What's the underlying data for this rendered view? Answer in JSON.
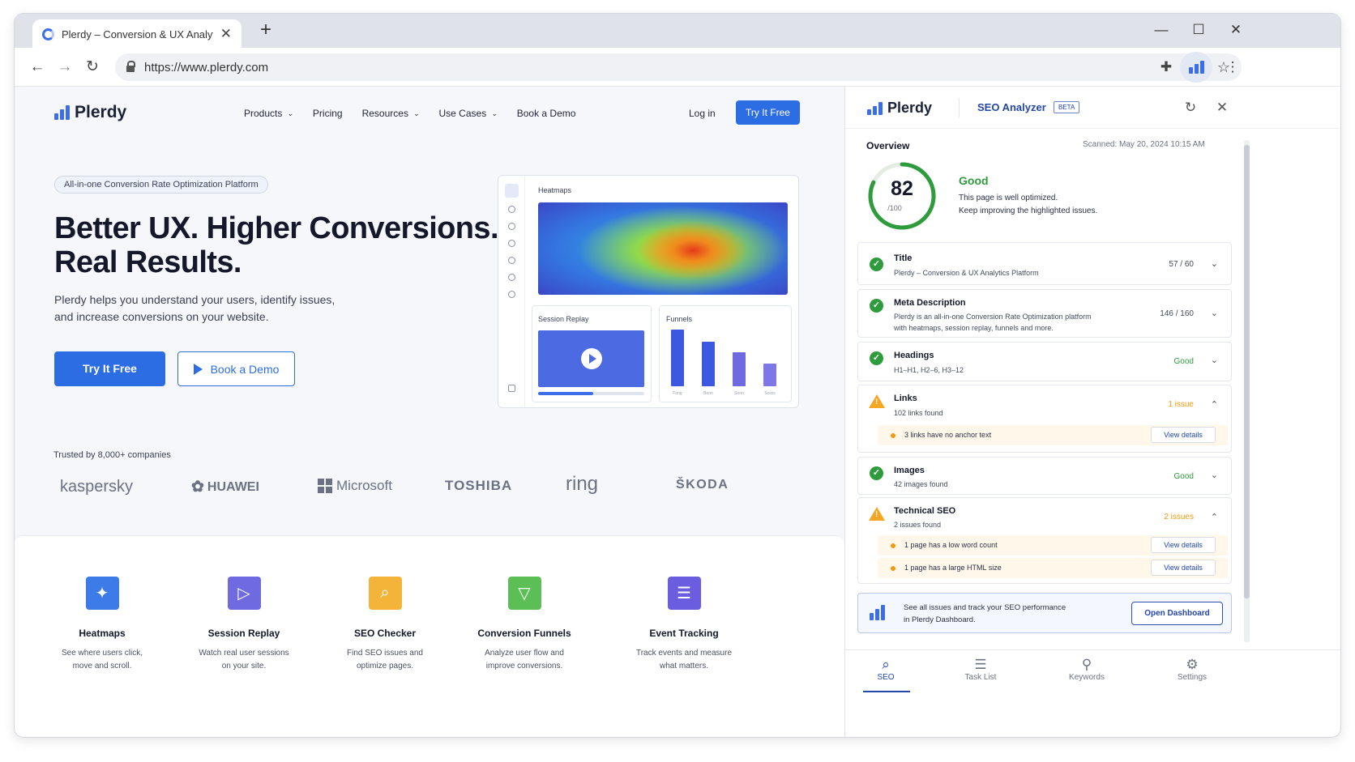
{
  "browser": {
    "tab_title": "Plerdy – Conversion & UX Analytics",
    "url": "https://www.plerdy.com",
    "new_tab": "+",
    "close_tab": "✕",
    "minimize": "—",
    "maximize": "☐",
    "close": "✕",
    "back": "←",
    "forward": "→",
    "reload": "↻",
    "star": "☆",
    "puzzle": "✚",
    "menu": "⋮"
  },
  "site": {
    "logo": "Plerdy",
    "nav": [
      {
        "label": "Products",
        "dropdown": "⌄"
      },
      {
        "label": "Pricing"
      },
      {
        "label": "Resources",
        "dropdown": "⌄"
      },
      {
        "label": "Use Cases",
        "dropdown": "⌄"
      },
      {
        "label": "Book a Demo"
      }
    ],
    "login": "Log in",
    "try_free_top": "Try It Free",
    "pill": "All-in-one Conversion Rate Optimization Platform",
    "headline_1": "Better UX. Higher Conversions.",
    "headline_2": "Real Results.",
    "subtext_1": "Plerdy helps you understand your users, identify issues,",
    "subtext_2": "and increase conversions on your website.",
    "cta_primary": "Try It Free",
    "cta_secondary": "Book a Demo",
    "mockup": {
      "heatmaps": "Heatmaps",
      "session_replay": "Session Replay",
      "session_progress": 0.52,
      "funnels": "Funnels",
      "funnel_values": [
        100,
        78,
        60,
        40
      ],
      "funnel_ticks": [
        "Fung",
        "Boon",
        "Soon",
        "Sosss"
      ]
    },
    "trusted": "Trusted by 8,000+ companies",
    "companies": [
      "kaspersky",
      "HUAWEI",
      "Microsoft",
      "TOSHIBA",
      "ring",
      "ŠKODA"
    ],
    "features": [
      {
        "title": "Heatmaps",
        "desc1": "See where users click,",
        "desc2": "move and scroll.",
        "color": "#3d7be9",
        "glyph": "✦"
      },
      {
        "title": "Session Replay",
        "desc1": "Watch real user sessions",
        "desc2": "on your site.",
        "color": "#6f6ae0",
        "glyph": "▷"
      },
      {
        "title": "SEO Checker",
        "desc1": "Find SEO issues and",
        "desc2": "optimize pages.",
        "color": "#f4b43a",
        "glyph": "⌕"
      },
      {
        "title": "Conversion Funnels",
        "desc1": "Analyze user flow and",
        "desc2": "improve conversions.",
        "color": "#5cbf55",
        "glyph": "▽"
      },
      {
        "title": "Event Tracking",
        "desc1": "Track events and measure",
        "desc2": "what matters.",
        "color": "#6b5de0",
        "glyph": "☰"
      }
    ]
  },
  "panel": {
    "logo": "Plerdy",
    "title": "SEO Analyzer",
    "beta": "BETA",
    "refresh": "↻",
    "close": "✕",
    "overview": "Overview",
    "scanned": "Scanned: May 20, 2024 10:15 AM",
    "score": "82",
    "score_max": "/100",
    "score_fraction": 0.82,
    "score_label": "Good",
    "score_text_1": "This page is well optimized.",
    "score_text_2": "Keep improving the highlighted issues.",
    "check_glyph": "✓",
    "warn_glyph": "!",
    "items": [
      {
        "title": "Title",
        "sub": "Plerdy – Conversion & UX Analytics Platform",
        "value": "57 / 60",
        "chevron": "⌄"
      },
      {
        "title": "Meta Description",
        "sub1": "Plerdy is an all-in-one Conversion Rate Optimization platform",
        "sub2": "with heatmaps, session replay, funnels and more.",
        "value": "146 / 160",
        "chevron": "⌄"
      },
      {
        "title": "Headings",
        "sub": "H1–H1, H2–6, H3–12",
        "value": "Good",
        "chevron": "⌄"
      },
      {
        "title": "Links",
        "sub": "102 links found",
        "value": "1 issue",
        "chevron": "⌃",
        "issues": [
          "3 links have no anchor text"
        ]
      },
      {
        "title": "Images",
        "sub": "42 images found",
        "value": "Good",
        "chevron": "⌄"
      },
      {
        "title": "Technical SEO",
        "sub": "2 issues found",
        "value": "2 issues",
        "chevron": "⌃",
        "issues": [
          "1 page has a low word count",
          "1 page has a large HTML size"
        ]
      }
    ],
    "view_details": "View details",
    "promo_1": "See all issues and track your SEO performance",
    "promo_2": "in Plerdy Dashboard.",
    "open_dashboard": "Open Dashboard",
    "bottom_nav": [
      {
        "label": "SEO",
        "glyph": "⌕"
      },
      {
        "label": "Task List",
        "glyph": "☰"
      },
      {
        "label": "Keywords",
        "glyph": "⚲"
      },
      {
        "label": "Settings",
        "glyph": "⚙"
      }
    ]
  },
  "colors": {
    "brand": "#2d6de4",
    "good": "#2e9b3c",
    "warning": "#f29a12"
  }
}
